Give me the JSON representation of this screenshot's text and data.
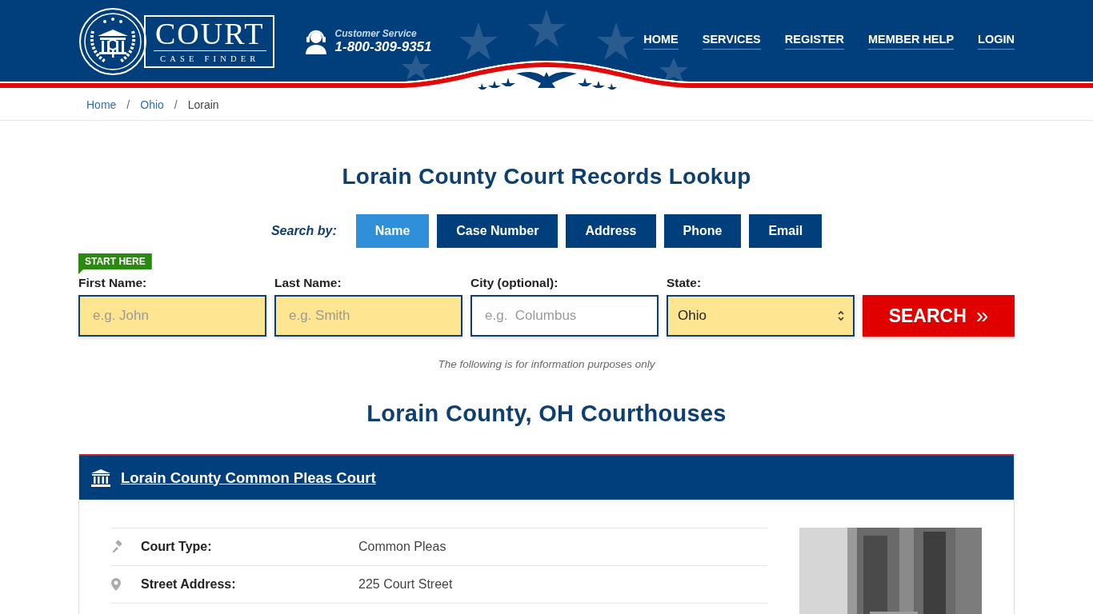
{
  "header": {
    "logo": {
      "title": "COURT",
      "subtitle": "CASE FINDER"
    },
    "contact": {
      "label": "Customer Service",
      "phone": "1-800-309-9351"
    },
    "nav": [
      {
        "label": "HOME"
      },
      {
        "label": "SERVICES"
      },
      {
        "label": "REGISTER"
      },
      {
        "label": "MEMBER HELP"
      },
      {
        "label": "LOGIN"
      }
    ]
  },
  "breadcrumb": [
    {
      "label": "Home",
      "current": false
    },
    {
      "separator": "/",
      "label": "Ohio",
      "current": false
    },
    {
      "separator": "/",
      "label": "Lorain",
      "current": true
    }
  ],
  "title": "Lorain County Court Records Lookup",
  "search": {
    "label": "Search by:",
    "tabs": [
      {
        "label": "Name",
        "selected": true
      },
      {
        "label": "Case Number",
        "selected": false
      },
      {
        "label": "Address",
        "selected": false
      },
      {
        "label": "Phone",
        "selected": false
      },
      {
        "label": "Email",
        "selected": false
      }
    ],
    "badge": "START HERE",
    "fields": [
      {
        "kind": "text",
        "label": "First Name:",
        "placeholder": "e.g. John",
        "highlighted": true
      },
      {
        "kind": "text",
        "label": "Last Name:",
        "placeholder": "e.g. Smith",
        "highlighted": true
      },
      {
        "kind": "text",
        "label": "City (optional):",
        "placeholder": "e.g.  Columbus",
        "highlighted": false
      },
      {
        "kind": "select",
        "label": "State:",
        "value": "Ohio",
        "highlighted": true
      }
    ],
    "button": {
      "label": "SEARCH",
      "icon": "»"
    },
    "note": "The following is for information purposes only"
  },
  "section_title": "Lorain County, OH Courthouses",
  "courthouses": [
    {
      "name": "Lorain County Common Pleas Court",
      "photo": {
        "kind": "picture"
      },
      "details": [
        {
          "kind": "type",
          "label": "Court Type:",
          "value": "Common Pleas"
        },
        {
          "kind": "address",
          "label": "Street Address:",
          "value": "225 Court Street"
        }
      ]
    }
  ]
}
